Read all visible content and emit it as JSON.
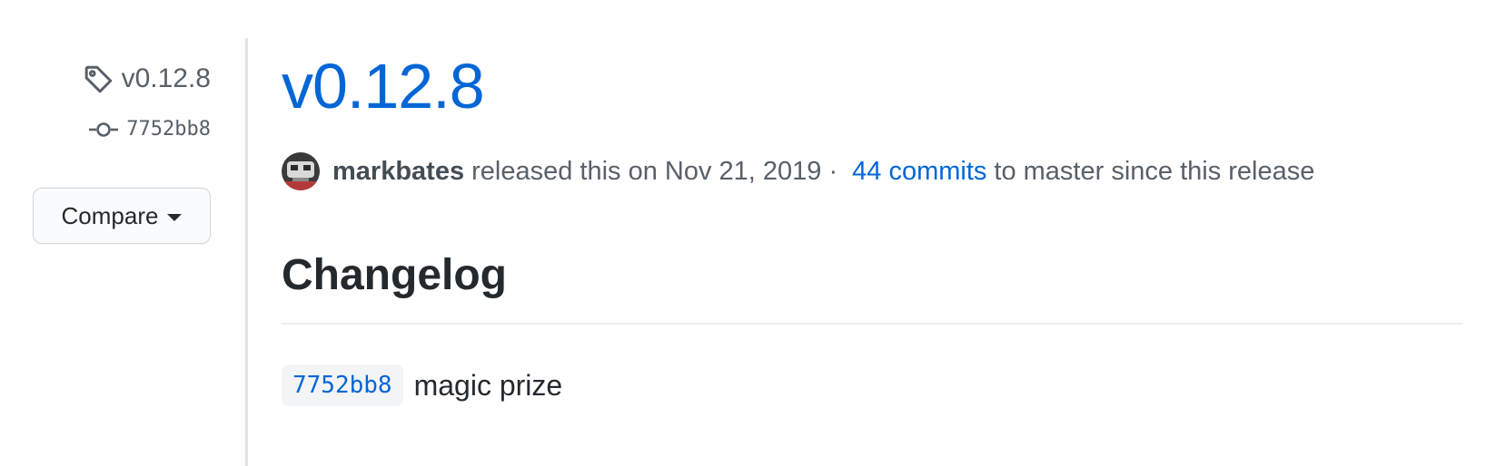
{
  "sidebar": {
    "tag_label": "v0.12.8",
    "commit_sha": "7752bb8",
    "compare_label": "Compare"
  },
  "release": {
    "title": "v0.12.8",
    "author": "markbates",
    "released_text": "released this on Nov 21, 2019 ·",
    "commits_link": "44 commits",
    "trailing_text": "to master since this release"
  },
  "body": {
    "heading": "Changelog",
    "entries": [
      {
        "sha": "7752bb8",
        "message": "magic prize"
      }
    ]
  },
  "colors": {
    "link": "#0366d6",
    "muted": "#586069",
    "text": "#24292e",
    "border": "#e1e4e8"
  },
  "icons": {
    "tag": "tag-icon",
    "commit": "git-commit-icon",
    "caret": "caret-down-icon"
  }
}
